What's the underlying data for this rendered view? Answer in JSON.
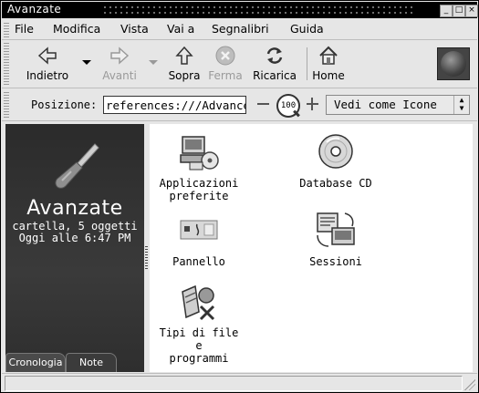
{
  "window": {
    "title": "Avanzate"
  },
  "menubar": {
    "items": [
      {
        "label": "File"
      },
      {
        "label": "Modifica"
      },
      {
        "label": "Vista"
      },
      {
        "label": "Vai a"
      },
      {
        "label": "Segnalibri"
      },
      {
        "label": "Guida"
      }
    ]
  },
  "toolbar": {
    "back": "Indietro",
    "forward": "Avanti",
    "up": "Sopra",
    "stop": "Ferma",
    "reload": "Ricarica",
    "home": "Home"
  },
  "location": {
    "label": "Posizione:",
    "value": "references:///Advanced",
    "zoom": "100",
    "view_mode": "Vedi come Icone"
  },
  "sidebar": {
    "title": "Avanzate",
    "info_line1": "cartella, 5 oggetti",
    "info_line2": "Oggi alle 6:47 PM",
    "tabs": [
      "Cronologia",
      "Note"
    ]
  },
  "files": [
    {
      "line1": "Applicazioni",
      "line2": "preferite",
      "icon": "preferred-apps-icon"
    },
    {
      "line1": "Database CD",
      "line2": "",
      "icon": "cd-icon"
    },
    {
      "line1": "Pannello",
      "line2": "",
      "icon": "panel-icon"
    },
    {
      "line1": "Sessioni",
      "line2": "",
      "icon": "sessions-icon"
    },
    {
      "line1": "Tipi di file e",
      "line2": "programmi",
      "icon": "file-types-icon"
    }
  ],
  "status": {
    "text": ""
  }
}
